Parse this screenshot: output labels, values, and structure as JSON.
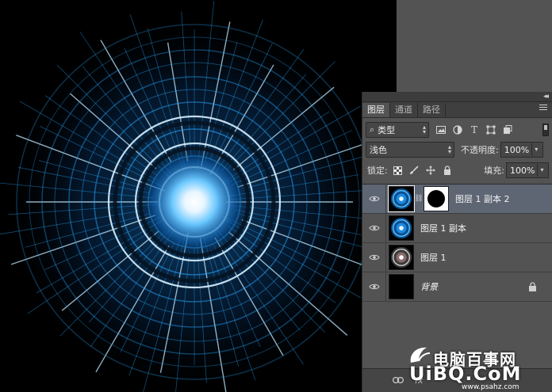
{
  "panel": {
    "tabs": [
      {
        "label": "图层",
        "active": true
      },
      {
        "label": "通道",
        "active": false
      },
      {
        "label": "路径",
        "active": false
      }
    ],
    "collapse_glyph": "◂◂",
    "filter_kind": "类型",
    "blend_mode": "浅色",
    "opacity_label": "不透明度:",
    "opacity_value": "100%",
    "lock_label": "锁定:",
    "fill_label": "填充:",
    "fill_value": "100%"
  },
  "layers": [
    {
      "name": "图层 1 副本 2",
      "selected": true,
      "has_mask": true,
      "locked": false,
      "thumb": "blue-ring"
    },
    {
      "name": "图层 1 副本",
      "selected": false,
      "has_mask": false,
      "locked": false,
      "thumb": "blue-ring"
    },
    {
      "name": "图层 1",
      "selected": false,
      "has_mask": false,
      "locked": false,
      "thumb": "white-ring"
    },
    {
      "name": "背景",
      "selected": false,
      "has_mask": false,
      "locked": true,
      "thumb": "black"
    }
  ],
  "icons": {
    "filter_icons": [
      "image-filter-icon",
      "adjustment-filter-icon",
      "text-filter-icon",
      "shape-filter-icon",
      "smart-object-filter-icon"
    ],
    "lock_icons": [
      "lock-transparent-icon",
      "lock-paint-icon",
      "lock-position-icon",
      "lock-all-icon"
    ],
    "footer_icons": [
      "link-layers-icon",
      "fx-icon"
    ]
  },
  "watermark": {
    "line1": "电脑百事网",
    "line2": "UiBQ.CoM",
    "line3": "www.psahz.com"
  },
  "colors": {
    "canvas_bg": "#000000",
    "glow": "#29a8ff",
    "panel_bg": "#535353",
    "selected_row": "#5e6674"
  }
}
